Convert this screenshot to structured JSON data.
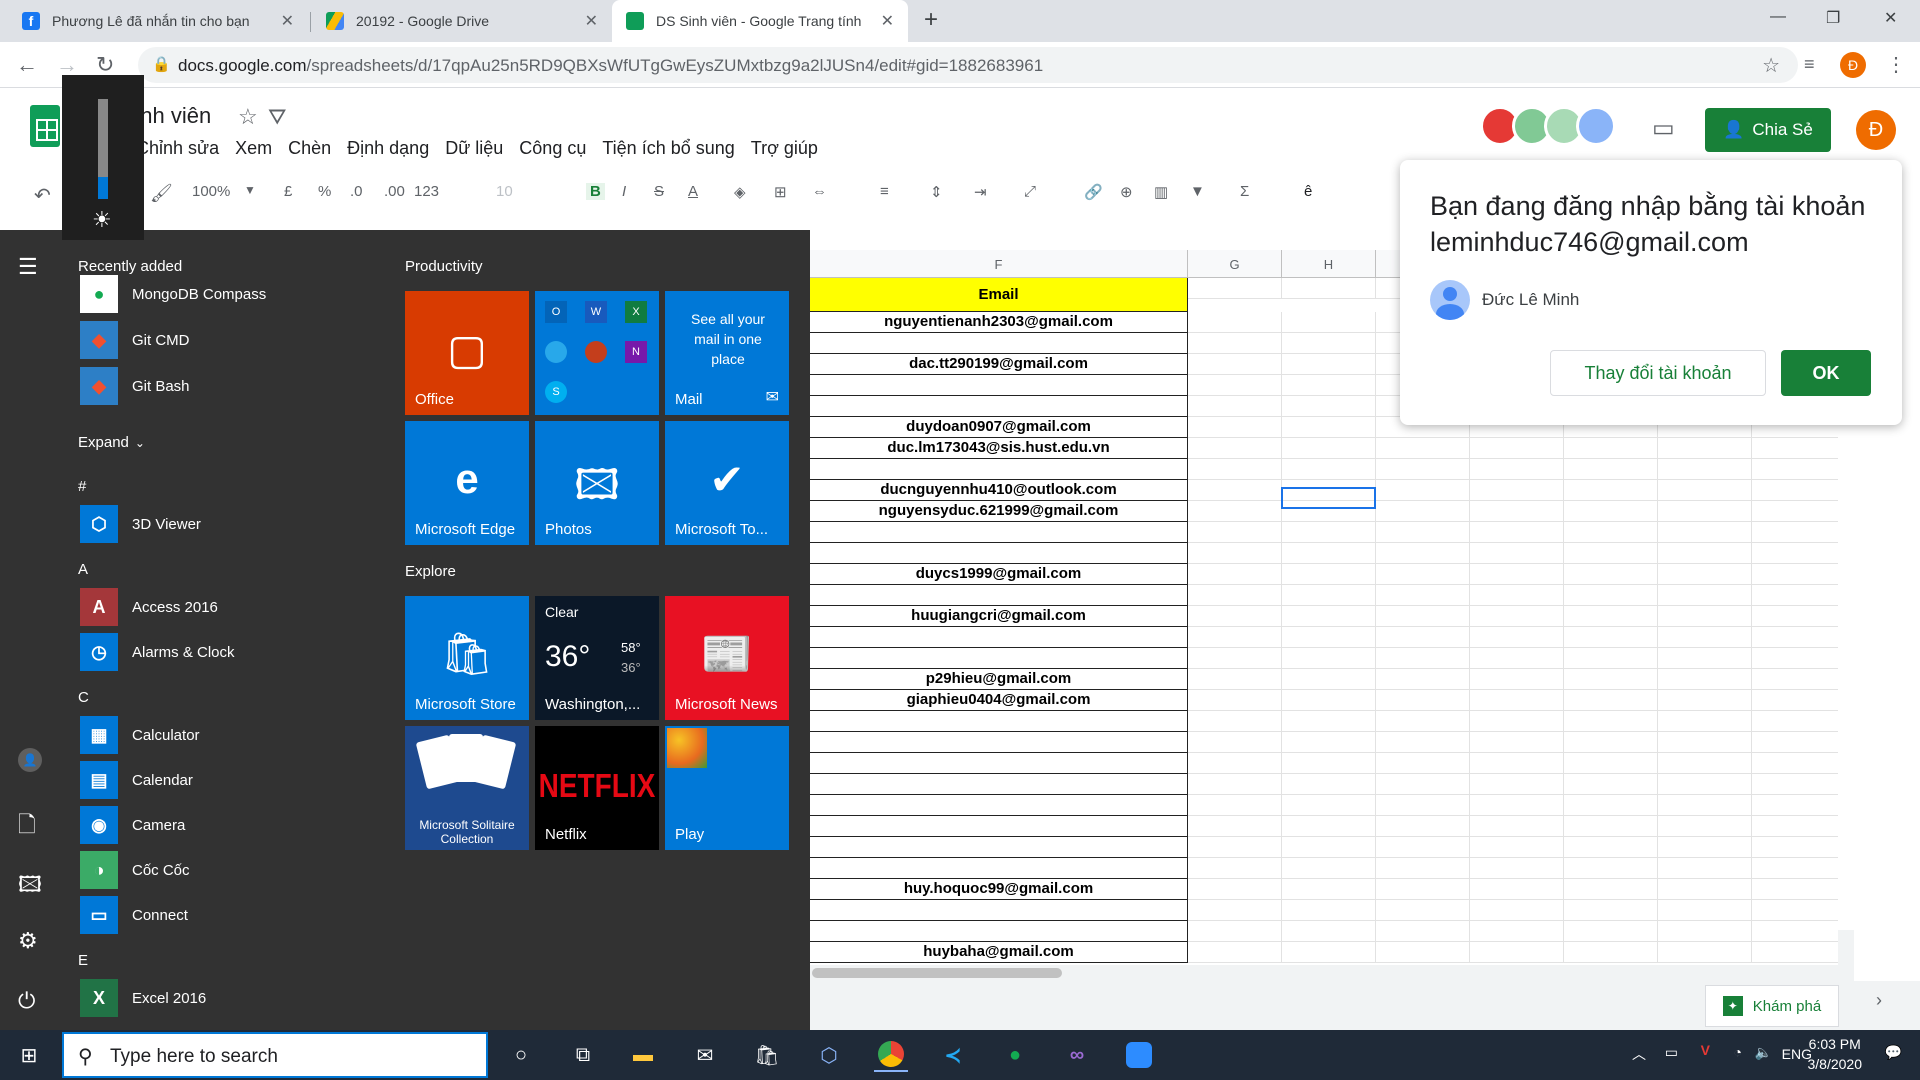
{
  "browser": {
    "tabs": [
      {
        "title": "Phương Lê đã nhắn tin cho bạn",
        "favicon_color": "#1877f2"
      },
      {
        "title": "20192 - Google Drive",
        "favicon_color": "#fbbc04"
      },
      {
        "title": "DS Sinh viên - Google Trang tính",
        "favicon_color": "#0f9d58"
      }
    ],
    "url_host": "docs.google.com",
    "url_path": "/spreadsheets/d/17qpAu25n5RD9QBXsWfUTgGwEysZUMxtbzg9a2lJUSn4/edit#gid=1882683961"
  },
  "sheets": {
    "doc_title": "DS Sinh viên",
    "menu": [
      "Chỉnh sửa",
      "Xem",
      "Chèn",
      "Định dạng",
      "Dữ liệu",
      "Công cụ",
      "Tiện ích bổ sung",
      "Trợ giúp"
    ],
    "toolbar": {
      "zoom": "100%",
      "currency": "£",
      "percent": "%",
      "dec_less": ".0",
      "dec_more": ".00",
      "format_123": "123",
      "font_size": "10"
    },
    "share_label": "Chia Sẻ",
    "user_initial": "Đ",
    "columns": [
      "F",
      "G",
      "H"
    ],
    "email_header": "Email",
    "email_rows": [
      "nguyentienanh2303@gmail.com",
      "",
      "dac.tt290199@gmail.com",
      "",
      "",
      "duydoan0907@gmail.com",
      "duc.lm173043@sis.hust.edu.vn",
      "",
      "ducnguyennhu410@outlook.com",
      "nguyensyduc.621999@gmail.com",
      "",
      "",
      "duycs1999@gmail.com",
      "",
      "huugiangcri@gmail.com",
      "",
      "",
      "p29hieu@gmail.com",
      "giaphieu0404@gmail.com",
      "",
      "",
      "",
      "",
      "",
      "",
      "",
      "",
      "huy.hoquoc99@gmail.com",
      "",
      "",
      "huybaha@gmail.com"
    ],
    "explore_label": "Khám phá"
  },
  "dialog": {
    "line1": "Bạn đang đăng nhập bằng tài khoản",
    "email": "leminhduc746@gmail.com",
    "account_name": "Đức Lê Minh",
    "change_label": "Thay đổi tài khoản",
    "ok_label": "OK"
  },
  "startmenu": {
    "recently_added_label": "Recently added",
    "expand_label": "Expand",
    "recent": [
      {
        "name": "MongoDB Compass",
        "color": "#ffffff",
        "glyph": "●",
        "fg": "#13aa52"
      },
      {
        "name": "Git CMD",
        "color": "#2d7fc6",
        "glyph": "◆",
        "fg": "#f1502f"
      },
      {
        "name": "Git Bash",
        "color": "#2d7fc6",
        "glyph": "◆",
        "fg": "#f1502f"
      }
    ],
    "sections": [
      {
        "letter": "#",
        "apps": [
          {
            "name": "3D Viewer",
            "color": "#0078d7",
            "glyph": "⬡",
            "fg": "#fff"
          }
        ]
      },
      {
        "letter": "A",
        "apps": [
          {
            "name": "Access 2016",
            "color": "#a4373a",
            "glyph": "A",
            "fg": "#fff"
          },
          {
            "name": "Alarms & Clock",
            "color": "#0078d7",
            "glyph": "◷",
            "fg": "#fff"
          }
        ]
      },
      {
        "letter": "C",
        "apps": [
          {
            "name": "Calculator",
            "color": "#0078d7",
            "glyph": "▦",
            "fg": "#fff"
          },
          {
            "name": "Calendar",
            "color": "#0078d7",
            "glyph": "▤",
            "fg": "#fff"
          },
          {
            "name": "Camera",
            "color": "#0078d7",
            "glyph": "◉",
            "fg": "#fff"
          },
          {
            "name": "Cốc Cốc",
            "color": "#3bab67",
            "glyph": "◑",
            "fg": "#fff"
          },
          {
            "name": "Connect",
            "color": "#0078d7",
            "glyph": "▭",
            "fg": "#fff"
          }
        ]
      },
      {
        "letter": "E",
        "apps": [
          {
            "name": "Excel 2016",
            "color": "#217346",
            "glyph": "X",
            "fg": "#fff"
          }
        ]
      }
    ],
    "productivity_label": "Productivity",
    "explore_label": "Explore",
    "tiles": {
      "office": "Office",
      "mail_text": "See all your mail in one place",
      "mail": "Mail",
      "edge": "Microsoft Edge",
      "photos": "Photos",
      "todo": "Microsoft To...",
      "store": "Microsoft Store",
      "weather_cond": "Clear",
      "weather_temp": "36°",
      "weather_hi": "58°",
      "weather_lo": "36°",
      "weather_loc": "Washington,...",
      "news": "Microsoft News",
      "solitaire": "Microsoft Solitaire Collection",
      "netflix_logo": "NETFLIX",
      "netflix": "Netflix",
      "play": "Play"
    },
    "brightness": 0.22
  },
  "taskbar": {
    "search_placeholder": "Type here to search",
    "lang": "ENG",
    "time": "6:03 PM",
    "date": "3/8/2020"
  }
}
